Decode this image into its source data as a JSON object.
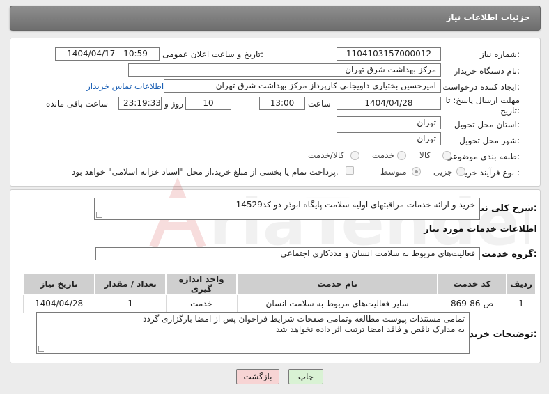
{
  "header": {
    "title": "جزئیات اطلاعات نیاز"
  },
  "form": {
    "need_number_label": "شماره نیاز:",
    "need_number": "1104103157000012",
    "announce_label": "تاریخ و ساعت اعلان عمومی:",
    "announce_value": "1404/04/17 - 10:59",
    "buyer_org_label": "نام دستگاه خریدار:",
    "buyer_org": "مرکز بهداشت شرق تهران",
    "creator_label": "ایجاد کننده درخواست:",
    "creator": "امیرحسین بختیاری داویجانی کارپرداز مرکز بهداشت شرق تهران",
    "contact_link": "اطلاعات تماس خریدار",
    "deadline_label_1": "مهلت ارسال پاسخ: تا",
    "deadline_label_2": "تاریخ:",
    "deadline_date": "1404/04/28",
    "hour_label": "ساعت",
    "deadline_time": "13:00",
    "days_value": "10",
    "days_label": "روز و",
    "remaining_time": "23:19:33",
    "remaining_label": "ساعت باقی مانده",
    "province_label": "استان محل تحویل:",
    "province": "تهران",
    "city_label": "شهر محل تحویل:",
    "city": "تهران",
    "category_label": "طبقه بندی موضوعی:",
    "category_options": [
      "کالا",
      "خدمت",
      "کالا/خدمت"
    ],
    "process_label": "نوع فرآیند خرید :",
    "process_options": [
      "جزیی",
      "متوسط"
    ],
    "payment_note": "پرداخت تمام یا بخشی از مبلغ خرید،از محل \"اسناد خزانه اسلامی\" خواهد بود."
  },
  "summary": {
    "label": "شرح کلی نیاز:",
    "text": "خرید و ارائه خدمات مراقبتهای اولیه سلامت پایگاه ابوذر دو کد14529"
  },
  "services": {
    "section_title": "اطلاعات خدمات مورد نیاز",
    "group_label": "گروه خدمت:",
    "group_value": "فعالیت‌های مربوط به سلامت انسان و مددکاری اجتماعی",
    "columns": [
      "ردیف",
      "کد خدمت",
      "نام خدمت",
      "واحد اندازه گیری",
      "تعداد / مقدار",
      "تاریخ نیاز"
    ],
    "rows": [
      [
        "1",
        "ص-86-869",
        "سایر فعالیت‌های مربوط به سلامت انسان",
        "خدمت",
        "1",
        "1404/04/28"
      ]
    ]
  },
  "notes": {
    "label": "توضیحات خریدار:",
    "line1": "تمامی مستندات پیوست مطالعه وتمامی صفحات شرایط فراخوان پس از امضا بارگزاری گردد",
    "line2": "به مدارک ناقص و فاقد امضا ترتیب اثر داده نخواهد شد"
  },
  "buttons": {
    "print": "چاپ",
    "back": "بازگشت"
  },
  "colors": {
    "header_bg": "#7d7d7d",
    "link": "#1a5fb4",
    "back_btn": "#f7d4d4",
    "print_btn": "#d9f2d4"
  }
}
